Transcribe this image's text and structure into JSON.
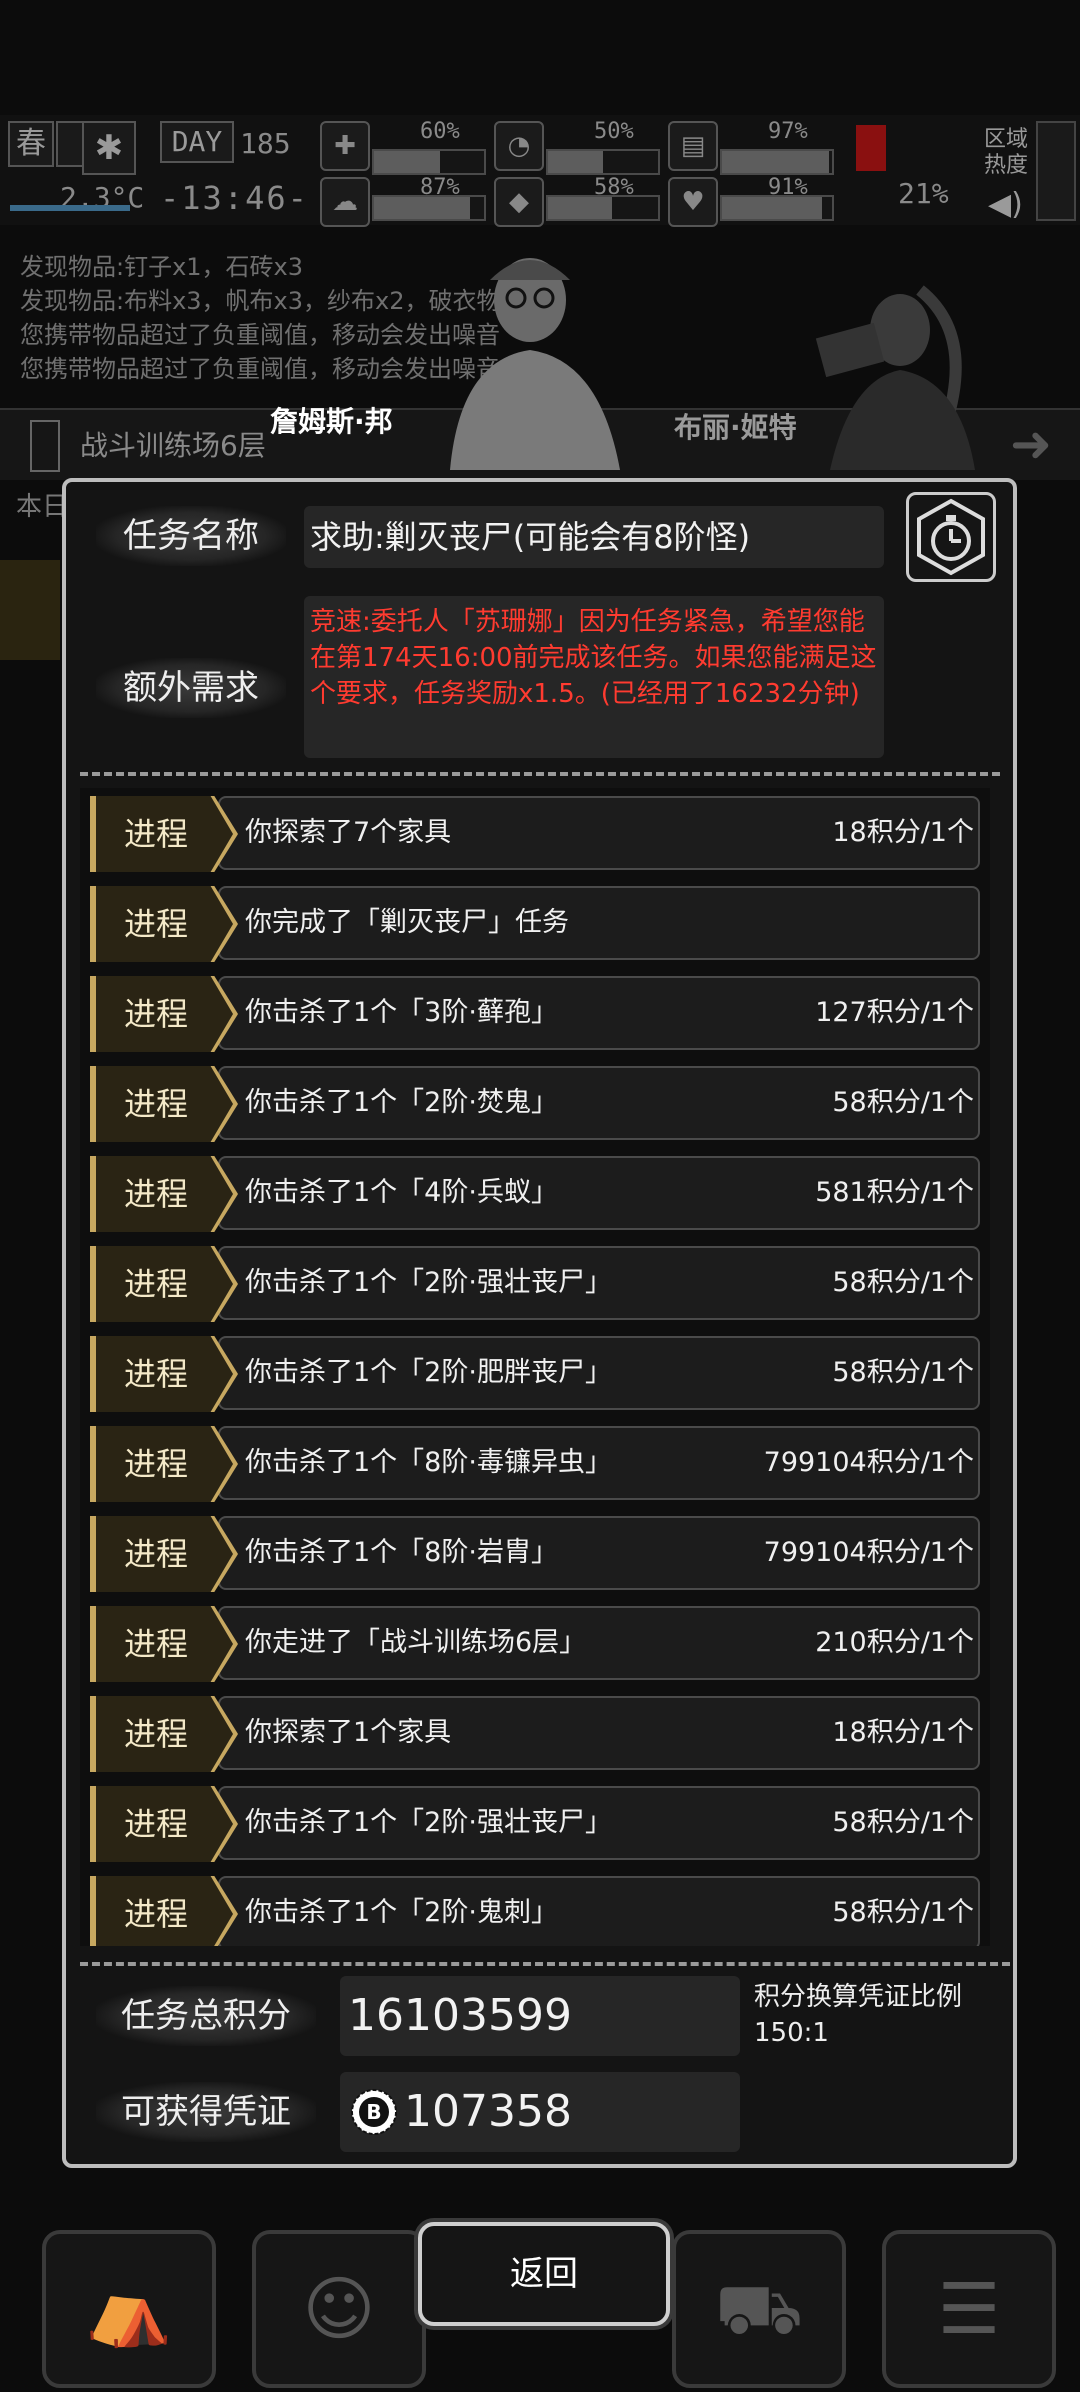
{
  "status_bar": {
    "season": "春",
    "day_label": "DAY",
    "day": "185",
    "temperature": "2.3°C",
    "time": "-13:46-",
    "stats_top": [
      "60%",
      "50%",
      "97%"
    ],
    "stats_bottom": [
      "87%",
      "58%",
      "91%"
    ],
    "stat_fill_top": [
      0.6,
      0.5,
      0.97
    ],
    "stat_fill_bottom": [
      0.87,
      0.58,
      0.91
    ],
    "extra_pct": "21%",
    "region_label": "区域热度",
    "icons": [
      "snowflake-icon",
      "medkit-icon",
      "stomach-icon",
      "canteen-icon",
      "brain-icon",
      "water-drop-icon",
      "heart-icon",
      "boot-icon",
      "speaker-icon"
    ]
  },
  "background_log": [
    "发现物品:钉子x1，石砖x3",
    "发现物品:布料x3，帆布x3，纱布x2，破衣物x3",
    "您携带物品超过了负重阈值，移动会发出噪音",
    "您携带物品超过了负重阈值，移动会发出噪音"
  ],
  "location": "战斗训练场6层",
  "location_sub": "本日",
  "characters": {
    "left_name": "詹姆斯·邦",
    "right_name": "布丽·姬特"
  },
  "task": {
    "name_label": "任务名称",
    "name_value": "求助:剿灭丧尸(可能会有8阶怪)",
    "extra_label": "额外需求",
    "extra_value": "竞速:委托人「苏珊娜」因为任务紧急，希望您能在第174天16:00前完成该任务。如果您能满足这个要求，任务奖励x1.5。(已经用了16232分钟)",
    "timer_icon": "stopwatch-icon"
  },
  "progress_tag": "进程",
  "progress_rows": [
    {
      "desc": "你探索了7个家具",
      "reward": "18积分/1个"
    },
    {
      "desc": "你完成了「剿灭丧尸」任务",
      "reward": ""
    },
    {
      "desc": "你击杀了1个「3阶·藓孢」",
      "reward": "127积分/1个"
    },
    {
      "desc": "你击杀了1个「2阶·焚鬼」",
      "reward": "58积分/1个"
    },
    {
      "desc": "你击杀了1个「4阶·兵蚁」",
      "reward": "581积分/1个"
    },
    {
      "desc": "你击杀了1个「2阶·强壮丧尸」",
      "reward": "58积分/1个"
    },
    {
      "desc": "你击杀了1个「2阶·肥胖丧尸」",
      "reward": "58积分/1个"
    },
    {
      "desc": "你击杀了1个「8阶·毒镰异虫」",
      "reward": "799104积分/1个"
    },
    {
      "desc": "你击杀了1个「8阶·岩胄」",
      "reward": "799104积分/1个"
    },
    {
      "desc": "你走进了「战斗训练场6层」",
      "reward": "210积分/1个"
    },
    {
      "desc": "你探索了1个家具",
      "reward": "18积分/1个"
    },
    {
      "desc": "你击杀了1个「2阶·强壮丧尸」",
      "reward": "58积分/1个"
    },
    {
      "desc": "你击杀了1个「2阶·鬼刺」",
      "reward": "58积分/1个"
    }
  ],
  "summary": {
    "total_label": "任务总积分",
    "total_value": "16103599",
    "ratio_label": "积分换算凭证比例",
    "ratio_value": "150:1",
    "voucher_label": "可获得凭证",
    "voucher_value": "107358",
    "voucher_icon": "bitcoin-coin-icon"
  },
  "back_button": "返回",
  "bottom_nav_icons": [
    "backpack-icon",
    "brain-profile-icon",
    "shopping-cart-icon",
    "menu-list-icon"
  ]
}
